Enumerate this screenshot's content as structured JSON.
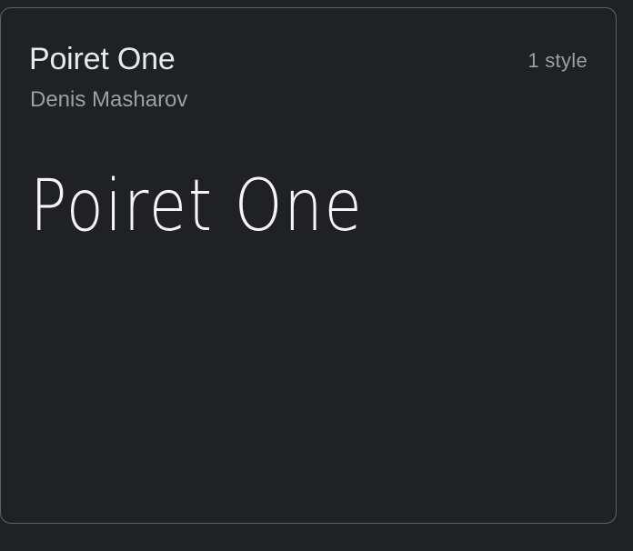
{
  "card": {
    "family_name": "Poiret One",
    "designer": "Denis Masharov",
    "style_count": "1 style",
    "specimen_text": "Poiret One"
  },
  "colors": {
    "background": "#202124",
    "border": "#5f6368",
    "primary_text": "#e8eaed",
    "secondary_text": "#9aa0a6",
    "specimen_text": "#ffffff"
  }
}
